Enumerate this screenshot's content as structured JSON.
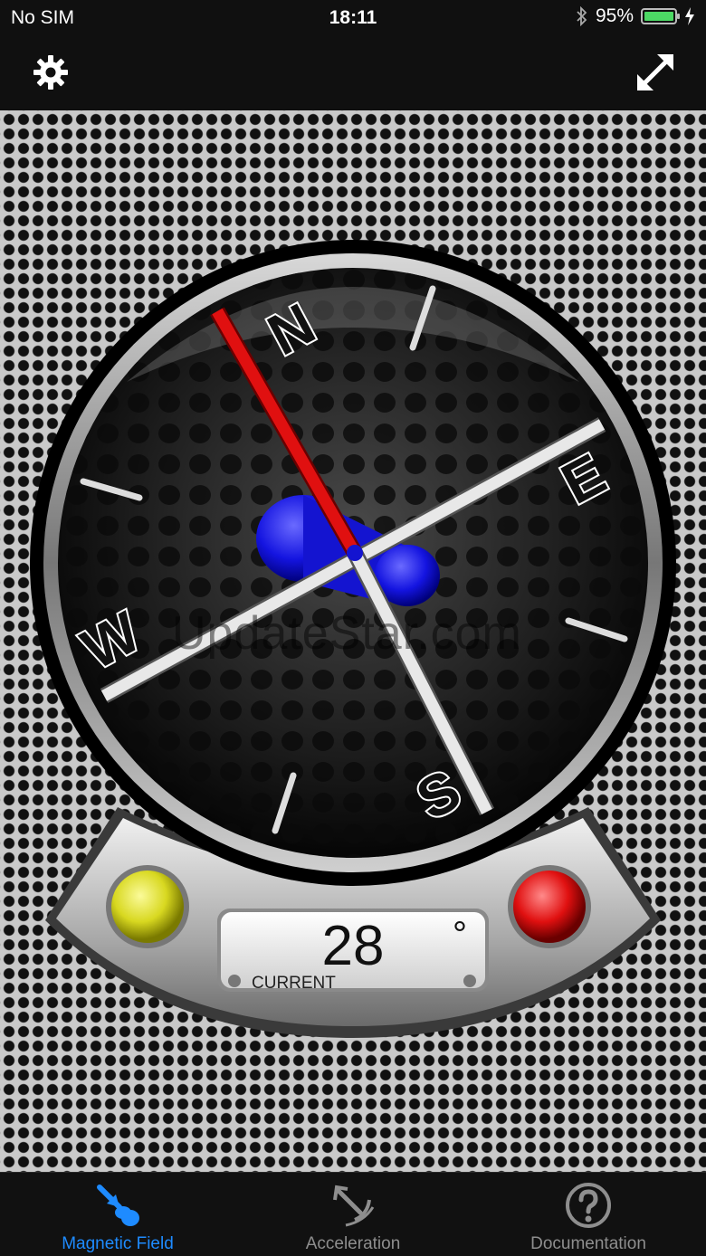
{
  "status_bar": {
    "carrier": "No SIM",
    "time": "18:11",
    "battery_percent": "95%",
    "battery_level": 0.95,
    "icons": [
      "bluetooth-icon",
      "battery-icon",
      "charging-bolt-icon"
    ]
  },
  "nav": {
    "left_icon": "gear-icon",
    "right_icon": "expand-arrows-icon"
  },
  "compass": {
    "labels": {
      "north": "N",
      "east": "E",
      "south": "S",
      "west": "W"
    },
    "needle_colors": {
      "north": "#e01010",
      "hub": "#1010e0"
    },
    "reading_value": "28",
    "reading_unit": "°",
    "reading_label": "CURRENT",
    "indicator_left_color": "#e6e632",
    "indicator_right_color": "#e01010"
  },
  "watermark": "UpdateStar.com",
  "tabs": [
    {
      "label": "Magnetic Field",
      "icon": "magnet-icon",
      "active": true
    },
    {
      "label": "Acceleration",
      "icon": "acceleration-icon",
      "active": false
    },
    {
      "label": "Documentation",
      "icon": "question-icon",
      "active": false
    }
  ],
  "colors": {
    "active_tab": "#1e8bff",
    "inactive_tab": "#8e8e8e"
  }
}
